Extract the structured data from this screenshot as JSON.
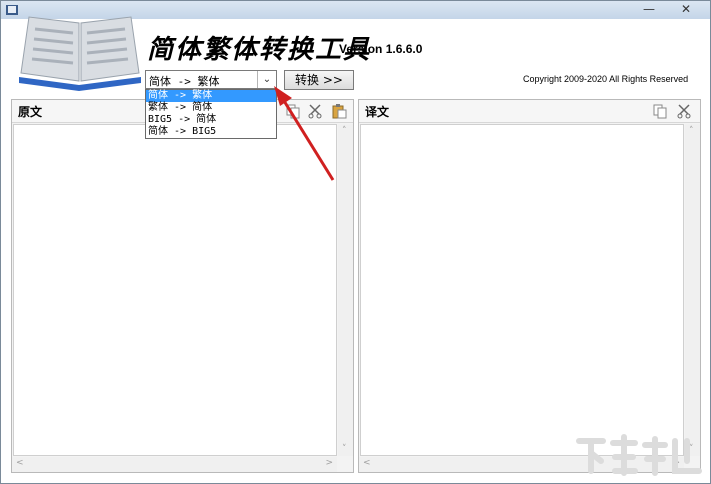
{
  "window": {
    "app_icon": "book-icon",
    "controls": {
      "minimize": "—",
      "close": "✕"
    }
  },
  "header": {
    "title": "简体繁体转换工具",
    "version": "Version 1.6.6.0",
    "copyright": "Copyright 2009-2020 All Rights Reserved",
    "logo": "open-book-logo"
  },
  "toolbar": {
    "combo_value": "简体 -> 繁体",
    "convert_label": "转换 >>",
    "options": [
      {
        "label": "简体 -> 繁体",
        "selected": true
      },
      {
        "label": "繁体 -> 简体",
        "selected": false
      },
      {
        "label": "BIG5 -> 简体",
        "selected": false
      },
      {
        "label": "简体 -> BIG5",
        "selected": false
      }
    ]
  },
  "panels": {
    "source": {
      "title": "原文",
      "tools": [
        "copy-icon",
        "cut-icon",
        "paste-icon"
      ]
    },
    "target": {
      "title": "译文",
      "tools": [
        "copy-icon",
        "cut-icon"
      ]
    }
  },
  "colors": {
    "selection": "#3399ff",
    "arrow": "#d02020"
  },
  "watermark": {
    "brand": "xiazaiba-logo"
  }
}
